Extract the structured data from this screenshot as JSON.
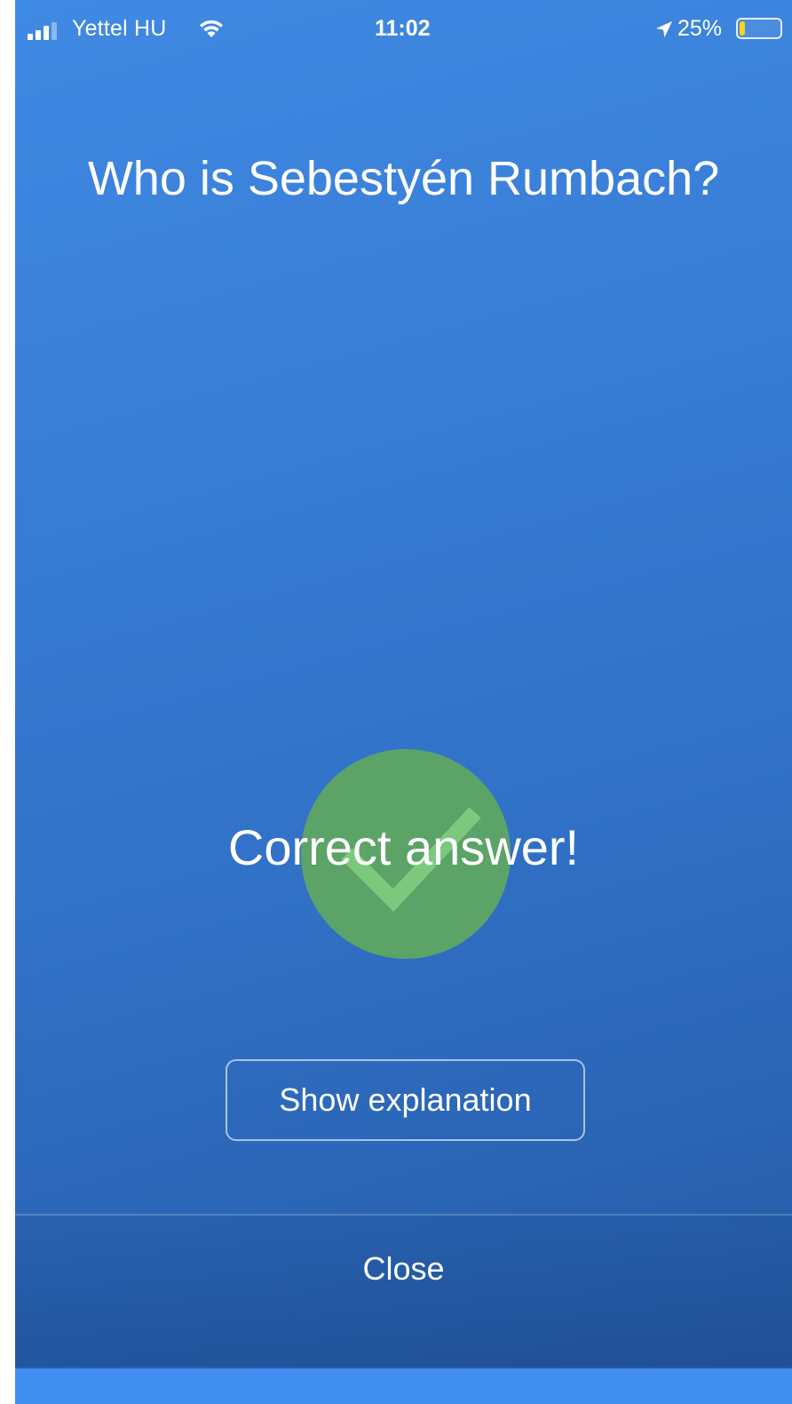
{
  "status_bar": {
    "carrier": "Yettel HU",
    "time": "11:02",
    "battery_percent": "25%",
    "battery_level": 0.25,
    "battery_color": "#ffd60a"
  },
  "quiz": {
    "question": "Who is Sebestyén Rumbach?",
    "result": "Correct answer!",
    "result_icon": "checkmark-icon",
    "result_color": "#5ca368"
  },
  "actions": {
    "show_explanation_label": "Show explanation",
    "close_label": "Close"
  },
  "theme": {
    "background_top": "#3f8ae3",
    "background_bottom": "#25579f"
  }
}
